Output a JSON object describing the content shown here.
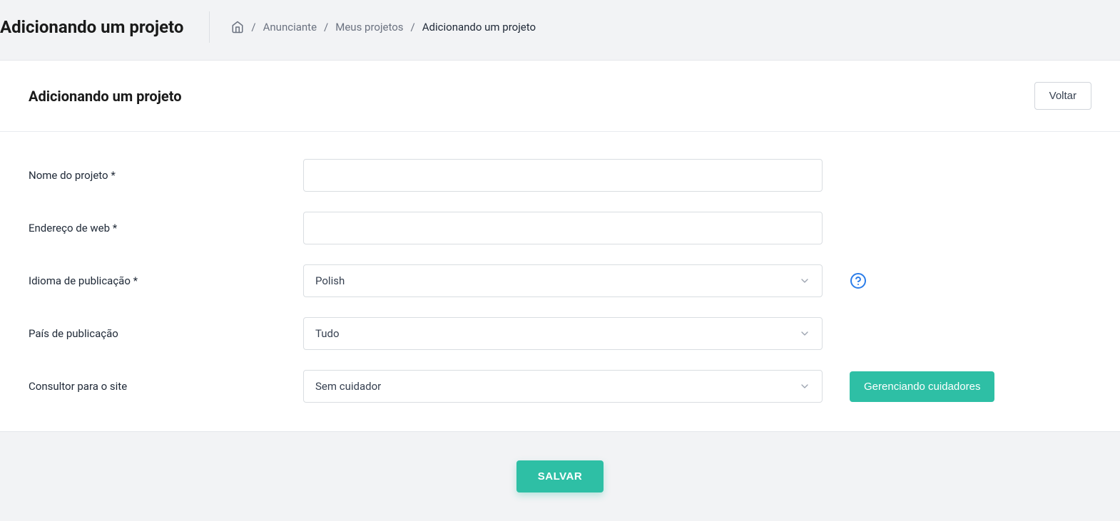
{
  "header": {
    "title": "Adicionando um projeto"
  },
  "breadcrumb": {
    "item1": "Anunciante",
    "item2": "Meus projetos",
    "current": "Adicionando um projeto"
  },
  "card": {
    "title": "Adicionando um projeto",
    "back_button": "Voltar"
  },
  "form": {
    "project_name": {
      "label": "Nome do projeto *",
      "value": ""
    },
    "web_address": {
      "label": "Endereço de web *",
      "value": ""
    },
    "publication_language": {
      "label": "Idioma de publicação *",
      "selected": "Polish"
    },
    "publication_country": {
      "label": "País de publicação",
      "selected": "Tudo"
    },
    "consultant": {
      "label": "Consultor para o site",
      "selected": "Sem cuidador",
      "manage_button": "Gerenciando cuidadores"
    }
  },
  "footer": {
    "save_button": "SALVAR"
  }
}
